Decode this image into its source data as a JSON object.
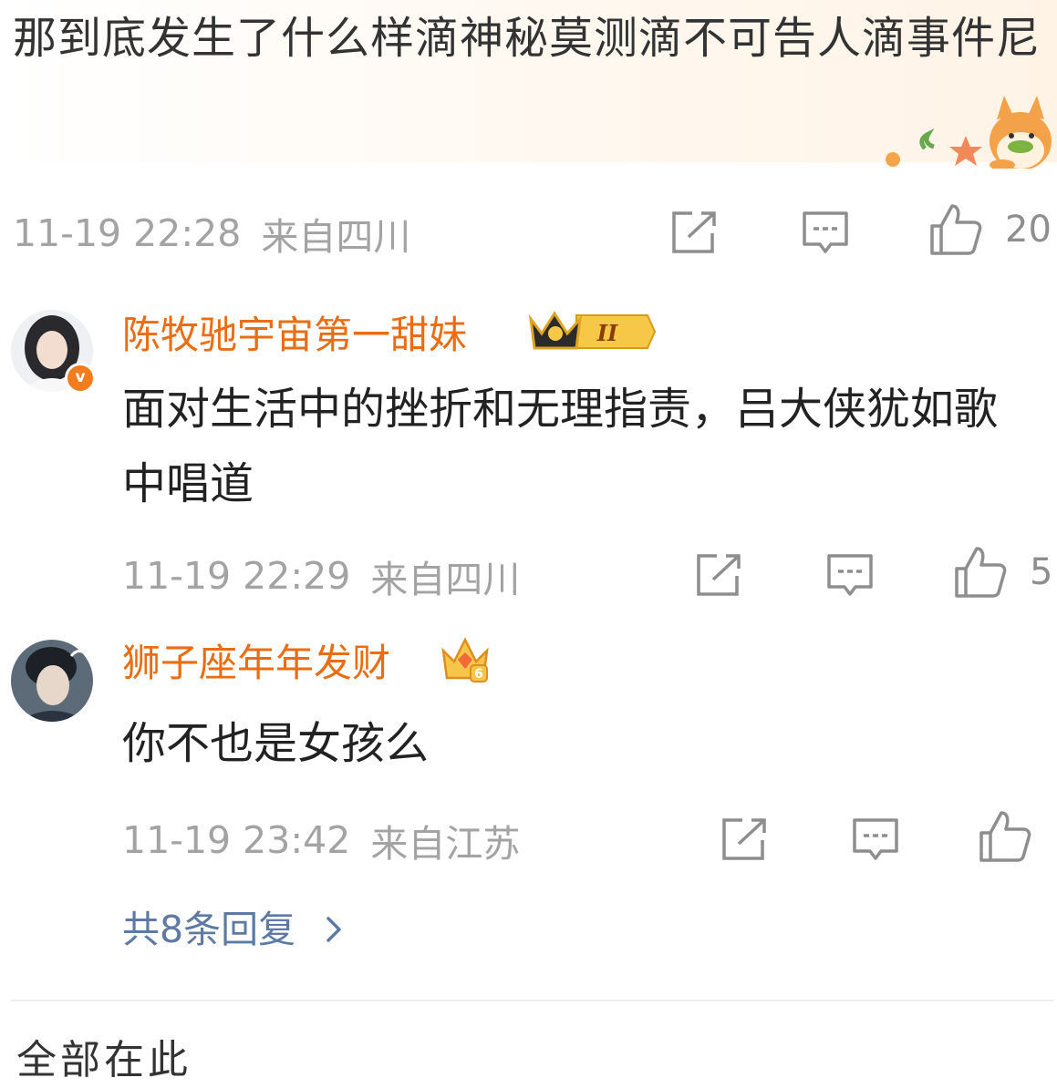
{
  "post": {
    "text": "那到底发生了什么样滴神秘莫测滴不可告人滴事件尼",
    "time": "11-19 22:28",
    "location": "来自四川",
    "like_count": "20"
  },
  "comments": [
    {
      "username": "陈牧驰宇宙第一甜妹",
      "badge_text": "II",
      "body": "面对生活中的挫折和无理指责，吕大侠犹如歌中唱道",
      "time": "11-19 22:29",
      "location": "来自四川",
      "like_count": "5"
    },
    {
      "username": "狮子座年年发财",
      "badge_text": "6",
      "body": "你不也是女孩么",
      "time": "11-19 23:42",
      "location": "来自江苏",
      "like_count": ""
    }
  ],
  "replies_link": "共8条回复",
  "bottom_partial": "全部在此",
  "icons": [
    "share-icon",
    "comment-icon",
    "like-icon",
    "chevron-right-icon",
    "crown-badge-icon",
    "verified-badge-icon"
  ],
  "colors": {
    "username": "#ea6d13",
    "link": "#5c7aa3",
    "meta": "#a3a3a3",
    "body": "#222222"
  }
}
